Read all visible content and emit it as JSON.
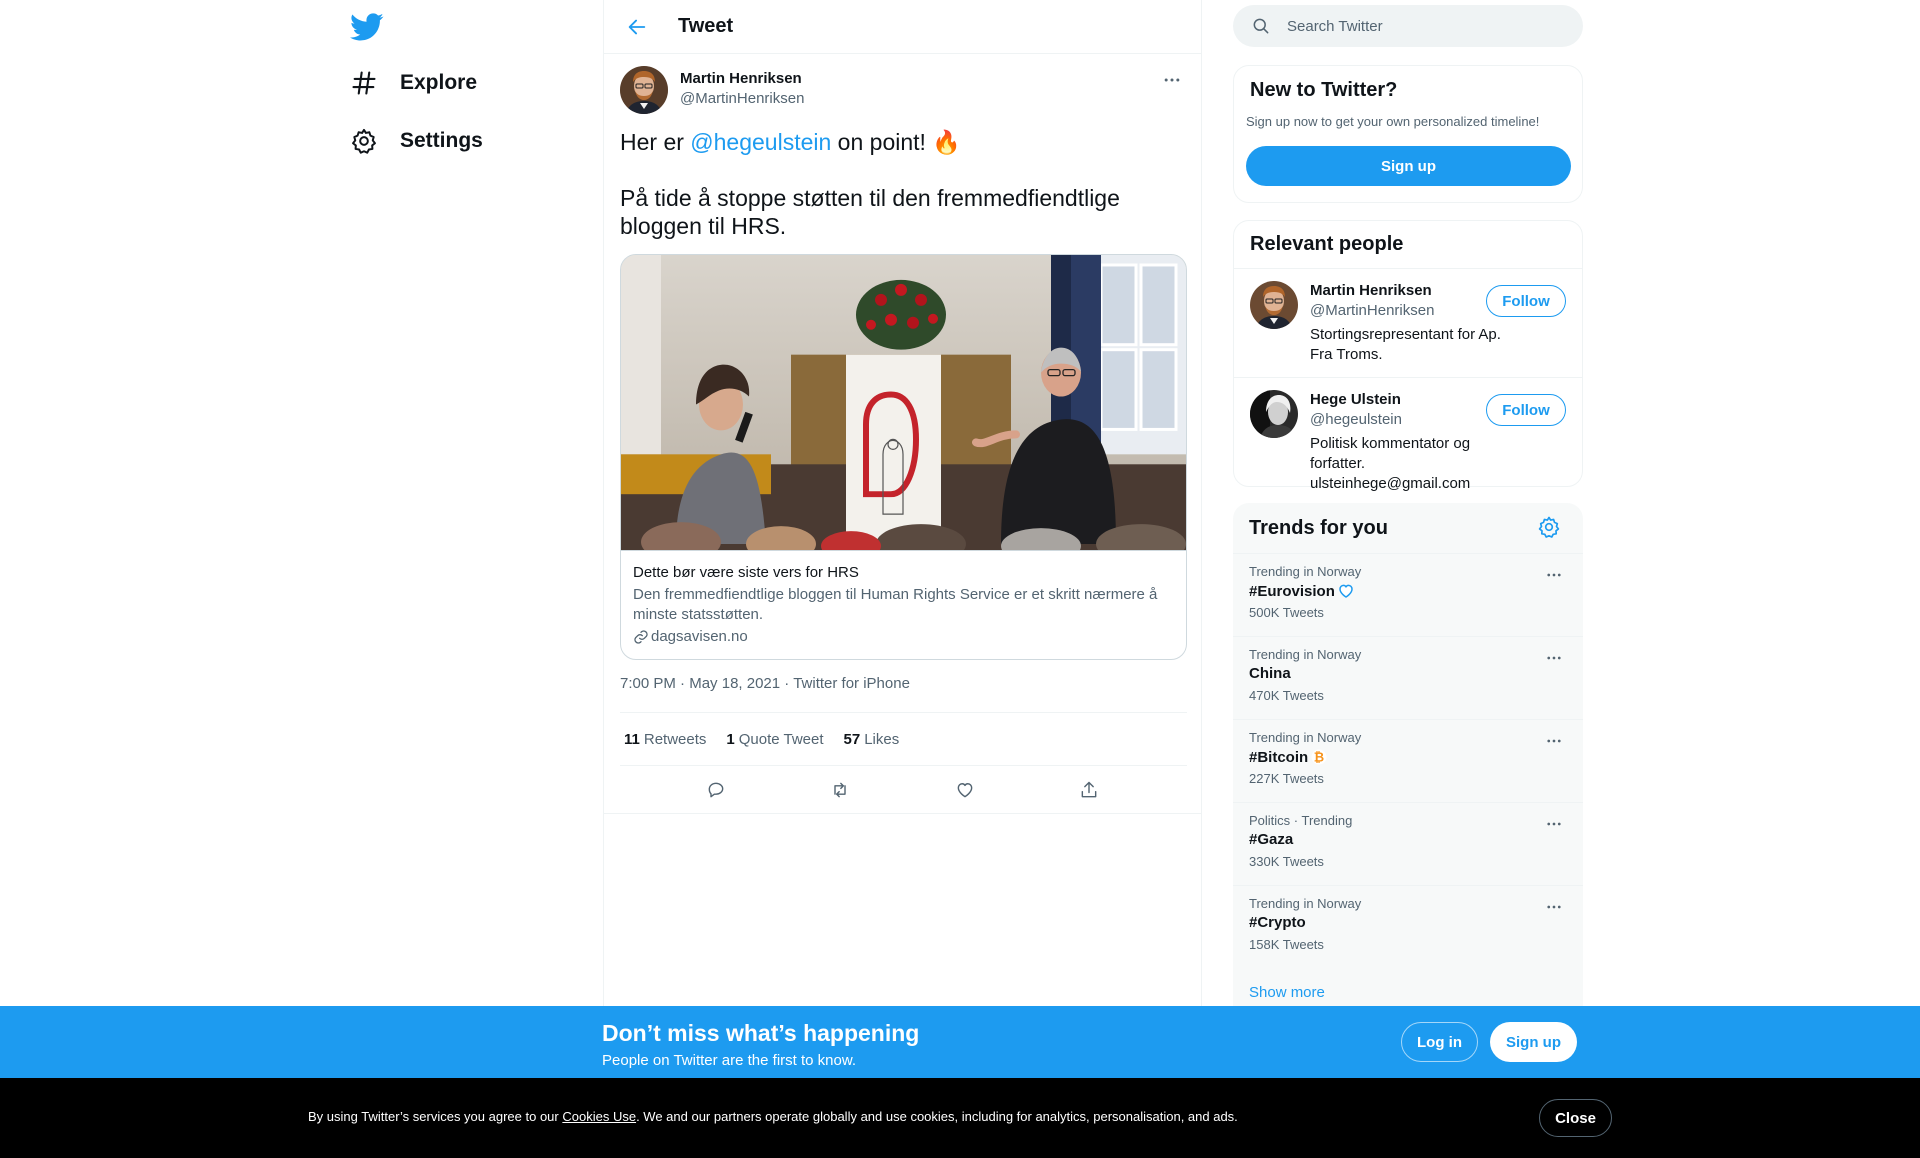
{
  "sidebar": {
    "logo_icon": "twitter-bird-icon",
    "items": [
      {
        "label": "Explore",
        "icon": "hashtag-icon"
      },
      {
        "label": "Settings",
        "icon": "gear-icon"
      }
    ]
  },
  "header": {
    "back_icon": "arrow-left-icon",
    "title": "Tweet"
  },
  "tweet": {
    "author_name": "Martin Henriksen",
    "author_handle": "@MartinHenriksen",
    "text_before": "Her er ",
    "mention": "@hegeulstein",
    "text_after": " on point! ",
    "emoji": "🔥",
    "text_line2": "På tide å stoppe støtten til den fremmedfiendtlige bloggen til HRS.",
    "card": {
      "title": "Dette bør være siste vers for HRS",
      "description": "Den fremmedfiendtlige bloggen til Human Rights Service er et skritt nærmere å minste statsstøtten.",
      "domain": "dagsavisen.no"
    },
    "time": "7:00 PM",
    "date": "May 18, 2021",
    "source": "Twitter for iPhone",
    "separator": "·",
    "stats": {
      "retweets_count": "11",
      "retweets_label": "Retweets",
      "quotes_count": "1",
      "quotes_label": "Quote Tweet",
      "likes_count": "57",
      "likes_label": "Likes"
    }
  },
  "search": {
    "placeholder": "Search Twitter"
  },
  "new_to_twitter": {
    "title": "New to Twitter?",
    "subtitle": "Sign up now to get your own personalized timeline!",
    "button": "Sign up"
  },
  "relevant_people": {
    "title": "Relevant people",
    "people": [
      {
        "name": "Martin Henriksen",
        "handle": "@MartinHenriksen",
        "bio": "Stortingsrepresentant for Ap. Fra Troms.",
        "follow": "Follow"
      },
      {
        "name": "Hege Ulstein",
        "handle": "@hegeulstein",
        "bio": "Politisk kommentator og forfatter. ulsteinhege@gmail.com",
        "follow": "Follow"
      }
    ]
  },
  "trends": {
    "title": "Trends for you",
    "items": [
      {
        "meta": "Trending in Norway",
        "name": "#Eurovision",
        "count": "500K Tweets",
        "icon": "heart-outline-icon"
      },
      {
        "meta": "Trending in Norway",
        "name": "China",
        "count": "470K Tweets",
        "icon": ""
      },
      {
        "meta": "Trending in Norway",
        "name": "#Bitcoin",
        "count": "227K Tweets",
        "icon": "bitcoin-icon"
      },
      {
        "meta": "Politics · Trending",
        "name": "#Gaza",
        "count": "330K Tweets",
        "icon": ""
      },
      {
        "meta": "Trending in Norway",
        "name": "#Crypto",
        "count": "158K Tweets",
        "icon": ""
      }
    ],
    "show_more": "Show more"
  },
  "banner": {
    "title": "Don’t miss what’s happening",
    "subtitle": "People on Twitter are the first to know.",
    "login": "Log in",
    "signup": "Sign up"
  },
  "cookie": {
    "text_before": "By using Twitter’s services you agree to our ",
    "link": "Cookies Use",
    "text_after": ". We and our partners operate globally and use cookies, including for analytics, personalisation, and ads.",
    "close": "Close"
  },
  "colors": {
    "accent": "#1d9bf0",
    "text": "#0f1419",
    "secondary": "#536471"
  }
}
